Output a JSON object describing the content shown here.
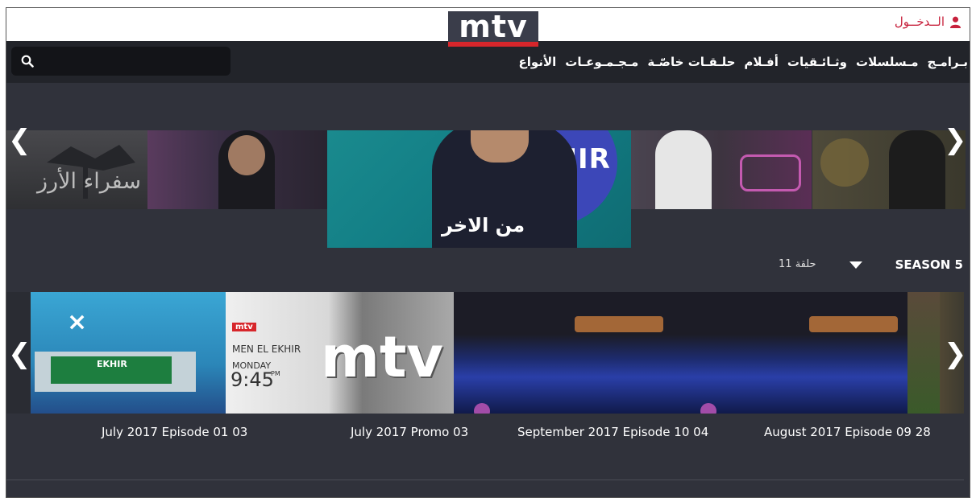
{
  "header": {
    "logo_text": "mtv",
    "login_label": "الــدخــول",
    "login_icon": "user-icon"
  },
  "nav": {
    "items": [
      "بـرامـج",
      "مـسلسلات",
      "وثـائـقيات",
      "أفـلام",
      "حلـقـات خاصّـة",
      "مـجـمـوعـات",
      "الأنواع"
    ],
    "search_icon": "search-icon"
  },
  "hero": {
    "title": "من الاخر",
    "banner_label": "EKHIR",
    "left_panel_text": "سفراء الأرز"
  },
  "season": {
    "label": "SEASON 5",
    "episodes": "11 حلقة"
  },
  "videos": [
    {
      "caption": "July 2017 Episode 01 03"
    },
    {
      "caption": "July 2017 Promo 03"
    },
    {
      "caption": "September 2017 Episode 10 04"
    },
    {
      "caption": "August 2017 Episode 09 28"
    }
  ],
  "promo": {
    "logo": "mtv",
    "show": "MEN EL EKHIR",
    "day": "MONDAY",
    "time": "9:45",
    "ampm": "PM",
    "big_logo": "mtv"
  },
  "colors": {
    "accent": "#c7213c",
    "brand_red": "#d7262b",
    "background": "#30323b",
    "nav_bg": "#22242a"
  }
}
